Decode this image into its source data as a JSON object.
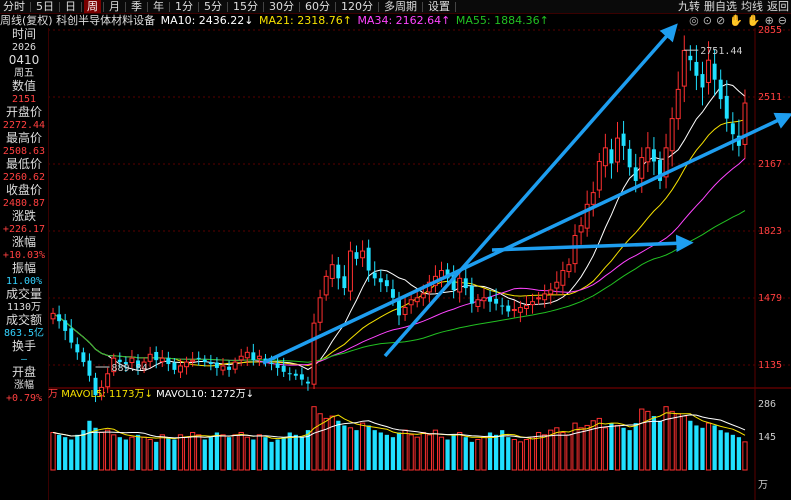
{
  "toolbar": {
    "items": [
      "分时",
      "5日",
      "日",
      "周",
      "月",
      "季",
      "年",
      "1分",
      "5分",
      "15分",
      "30分",
      "60分",
      "120分",
      "多周期",
      "设置"
    ],
    "active_index": 3,
    "right_items": [
      "九转",
      "删自选",
      "均线",
      "返回"
    ]
  },
  "info": {
    "title": "周线(复权) 科创半导体材料设备",
    "ma10": "MA10: 2436.22↓",
    "ma21": "MA21: 2318.76↑",
    "ma34": "MA34: 2162.64↑",
    "ma55": "MA55: 1884.36↑"
  },
  "controls": [
    "◎",
    "⊙",
    "⊘",
    "✋",
    "✋",
    "⊕",
    "⊖"
  ],
  "sidebar": [
    {
      "label": "时间",
      "value": "2026"
    },
    {
      "label": "0410",
      "value": "周五"
    },
    {
      "label": "数值",
      "value": "2151",
      "value_color": "#ff4040"
    },
    {
      "label": "开盘价",
      "value": "2272.44",
      "value_color": "#ff4040"
    },
    {
      "label": "最高价",
      "value": "2508.63",
      "value_color": "#ff4040"
    },
    {
      "label": "最低价",
      "value": "2260.62",
      "value_color": "#ff4040"
    },
    {
      "label": "收盘价",
      "value": "2480.87",
      "value_color": "#ff4040"
    },
    {
      "label": "涨跌",
      "value": "+226.17",
      "value_color": "#ff4040"
    },
    {
      "label": "涨幅",
      "value": "+10.03%",
      "value_color": "#ff4040"
    },
    {
      "label": "振幅",
      "value": "11.00%",
      "value_color": "#34d3ff"
    },
    {
      "label": "成交量",
      "value": "1130万",
      "value_color": "#ddd"
    },
    {
      "label": "成交额",
      "value": "863.5亿",
      "value_color": "#34d3ff"
    },
    {
      "label": "换手",
      "value": "—",
      "value_color": "#34d3ff"
    },
    {
      "label": "开盘",
      "value": "涨幅",
      "value_color": "#ddd"
    },
    {
      "label": "",
      "value": "+0.79%",
      "value_color": "#ff4040"
    }
  ],
  "price_axis": [
    "2855",
    "2511",
    "2167",
    "1823",
    "1479",
    "1135"
  ],
  "vol_axis": [
    "286",
    "145",
    "万"
  ],
  "annotations": {
    "high_label": "2751.44",
    "low_label": "889.84"
  },
  "volume_info": {
    "unit": "万",
    "mavol5": "MAVOL5: 1173万↓",
    "mavol10": "MAVOL10: 1272万↓"
  },
  "colors": {
    "up": "#ff3030",
    "down": "#20e0ff",
    "ma10": "#ffffff",
    "ma21": "#f5e100",
    "ma34": "#ff44ff",
    "ma55": "#22c022",
    "arrow": "#1e9ef0",
    "grid": "#5a0000"
  },
  "chart_data": {
    "type": "candlestick",
    "closes": [
      1400,
      1360,
      1310,
      1250,
      1200,
      1150,
      1080,
      980,
      1020,
      1090,
      1170,
      1150,
      1140,
      1170,
      1120,
      1150,
      1190,
      1160,
      1170,
      1140,
      1110,
      1130,
      1150,
      1160,
      1170,
      1150,
      1140,
      1120,
      1130,
      1110,
      1150,
      1180,
      1200,
      1160,
      1180,
      1150,
      1140,
      1120,
      1100,
      1090,
      1080,
      1060,
      1040,
      1350,
      1480,
      1590,
      1650,
      1580,
      1530,
      1720,
      1680,
      1720,
      1620,
      1580,
      1560,
      1540,
      1480,
      1390,
      1430,
      1470,
      1480,
      1500,
      1560,
      1590,
      1620,
      1580,
      1520,
      1580,
      1530,
      1450,
      1470,
      1480,
      1460,
      1450,
      1440,
      1410,
      1420,
      1430,
      1440,
      1460,
      1480,
      1500,
      1520,
      1560,
      1620,
      1650,
      1800,
      1850,
      1960,
      2020,
      2180,
      2250,
      2170,
      2300,
      2260,
      2150,
      2080,
      2200,
      2250,
      2180,
      2080,
      2250,
      2400,
      2550,
      2750,
      2700,
      2620,
      2560,
      2700,
      2600,
      2500,
      2400,
      2320,
      2260,
      2480
    ],
    "ma_series": [
      "MA10",
      "MA21",
      "MA34",
      "MA55"
    ],
    "high": 2751.44,
    "low": 889.84,
    "ylim": [
      1135,
      2855
    ]
  },
  "volume_data": [
    160,
    150,
    140,
    130,
    150,
    170,
    210,
    180,
    160,
    170,
    150,
    140,
    130,
    140,
    150,
    140,
    130,
    120,
    150,
    140,
    130,
    150,
    140,
    160,
    150,
    130,
    140,
    160,
    150,
    140,
    150,
    160,
    140,
    130,
    150,
    140,
    120,
    130,
    140,
    160,
    150,
    140,
    170,
    270,
    240,
    220,
    230,
    210,
    190,
    180,
    170,
    200,
    190,
    170,
    160,
    150,
    140,
    160,
    170,
    150,
    140,
    160,
    150,
    170,
    140,
    130,
    150,
    160,
    140,
    120,
    130,
    140,
    160,
    150,
    170,
    140,
    130,
    120,
    130,
    140,
    160,
    150,
    170,
    180,
    160,
    150,
    200,
    180,
    190,
    210,
    220,
    180,
    200,
    190,
    180,
    170,
    200,
    260,
    250,
    230,
    210,
    270,
    250,
    240,
    230,
    210,
    190,
    180,
    200,
    190,
    170,
    160,
    150,
    140,
    120
  ]
}
